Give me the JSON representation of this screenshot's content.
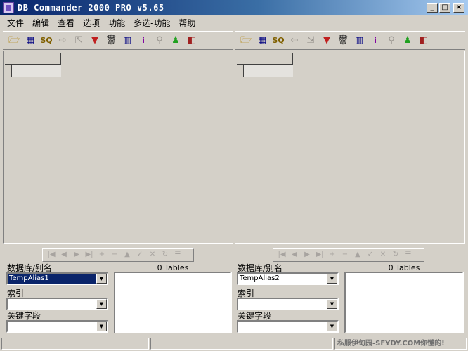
{
  "window": {
    "title": "DB Commander 2000 PRO v5.65",
    "controls": [
      "_",
      "□",
      "×"
    ]
  },
  "menu": [
    "文件",
    "编辑",
    "查看",
    "选项",
    "功能",
    "多选-功能",
    "帮助"
  ],
  "toolbar_left": [
    {
      "name": "open-folder-icon",
      "glyph": "🗁",
      "color": "#b08000"
    },
    {
      "name": "table-icon",
      "glyph": "▦",
      "color": "#000080"
    },
    {
      "name": "sql-icon",
      "glyph": "SQ",
      "color": "#806000"
    },
    {
      "name": "arrow-right-icon",
      "glyph": "⇨",
      "color": "#9a9690"
    },
    {
      "name": "export-icon",
      "glyph": "⇱",
      "color": "#9a9690"
    },
    {
      "name": "filter-icon",
      "glyph": "▼",
      "color": "#c02020"
    },
    {
      "name": "trash-icon",
      "glyph": "🗑",
      "color": "#202020"
    },
    {
      "name": "batch-icon",
      "glyph": "▥",
      "color": "#000080"
    },
    {
      "name": "info-icon",
      "glyph": "i",
      "color": "#8000a0"
    },
    {
      "name": "search-icon",
      "glyph": "⚲",
      "color": "#9a9690"
    },
    {
      "name": "run-icon",
      "glyph": "♟",
      "color": "#20a020"
    },
    {
      "name": "exit-icon",
      "glyph": "◧",
      "color": "#a02020"
    }
  ],
  "toolbar_right": [
    {
      "name": "open-folder-icon",
      "glyph": "🗁",
      "color": "#b08000"
    },
    {
      "name": "table-icon",
      "glyph": "▦",
      "color": "#000080"
    },
    {
      "name": "sql-icon",
      "glyph": "SQ",
      "color": "#806000"
    },
    {
      "name": "arrow-left-icon",
      "glyph": "⇦",
      "color": "#9a9690"
    },
    {
      "name": "export-icon",
      "glyph": "⇲",
      "color": "#9a9690"
    },
    {
      "name": "filter-icon",
      "glyph": "▼",
      "color": "#c02020"
    },
    {
      "name": "trash-icon",
      "glyph": "🗑",
      "color": "#202020"
    },
    {
      "name": "batch-icon",
      "glyph": "▥",
      "color": "#000080"
    },
    {
      "name": "info-icon",
      "glyph": "i",
      "color": "#8000a0"
    },
    {
      "name": "search-icon",
      "glyph": "⚲",
      "color": "#9a9690"
    },
    {
      "name": "run-icon",
      "glyph": "♟",
      "color": "#20a020"
    },
    {
      "name": "exit-icon",
      "glyph": "◧",
      "color": "#a02020"
    }
  ],
  "nav_buttons": [
    {
      "name": "first-record-icon",
      "glyph": "|◀"
    },
    {
      "name": "prior-record-icon",
      "glyph": "◀"
    },
    {
      "name": "next-record-icon",
      "glyph": "▶"
    },
    {
      "name": "last-record-icon",
      "glyph": "▶|"
    },
    {
      "name": "insert-record-icon",
      "glyph": "+"
    },
    {
      "name": "delete-record-icon",
      "glyph": "−"
    },
    {
      "name": "edit-record-icon",
      "glyph": "▲"
    },
    {
      "name": "post-record-icon",
      "glyph": "✓"
    },
    {
      "name": "cancel-record-icon",
      "glyph": "✕"
    },
    {
      "name": "refresh-icon",
      "glyph": "↻"
    },
    {
      "name": "grid-options-icon",
      "glyph": "☰"
    }
  ],
  "left": {
    "db_label": "数据库/别名",
    "db_value": "TempAlias1",
    "index_label": "索引",
    "index_value": "",
    "key_label": "关键字段",
    "key_value": "",
    "tables_label": "0 Tables"
  },
  "right": {
    "db_label": "数据库/别名",
    "db_value": "TempAlias2",
    "index_label": "索引",
    "index_value": "",
    "key_label": "关键字段",
    "key_value": "",
    "tables_label": "0 Tables"
  },
  "status": {
    "panel1": "",
    "panel2": "",
    "panel3": "私服伊甸园-SFYDY.COM你懂的!"
  }
}
